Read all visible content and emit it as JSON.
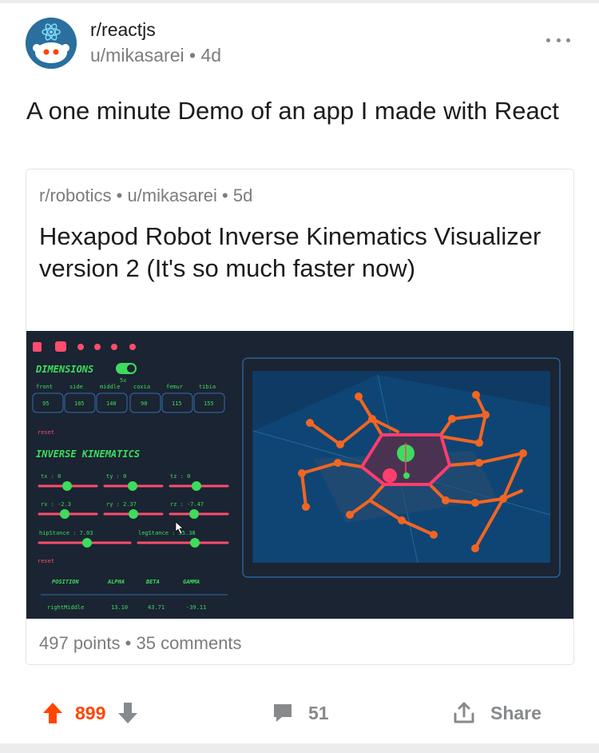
{
  "post": {
    "subreddit": "r/reactjs",
    "author": "u/mikasarei",
    "age": "4d",
    "title": "A one minute Demo of an app I made with React"
  },
  "crosspost": {
    "subreddit": "r/robotics",
    "author": "u/mikasarei",
    "age": "5d",
    "title": "Hexapod Robot Inverse Kinematics Visualizer version 2 (It's so much faster now)",
    "points": "497 points",
    "comments": "35 comments"
  },
  "media": {
    "dimensions_title": "DIMENSIONS",
    "scale": "5x",
    "dim_labels": [
      "front",
      "side",
      "middle",
      "coxia",
      "femur",
      "tibia"
    ],
    "dim_values": [
      "95",
      "105",
      "140",
      "90",
      "115",
      "155"
    ],
    "reset": "reset",
    "ik_title": "INVERSE KINEMATICS",
    "sliders": [
      "tx : 0",
      "ty : 0",
      "tz : 0",
      "rx : -2.3",
      "ry : 2.37",
      "rz : -7.47"
    ],
    "hip_stance": "hipStance : 7.03",
    "leg_stance": "legStance : 35.38",
    "table_headers": [
      "POSITION",
      "ALPHA",
      "BETA",
      "GAMMA"
    ],
    "table_row": [
      "rightMiddle",
      "13.10",
      "43.71",
      "-39.11"
    ],
    "accent": "#3ddc5c",
    "leg_color": "#f26522",
    "body_color": "#ff3d6e"
  },
  "actions": {
    "score": "899",
    "comments": "51",
    "share": "Share"
  },
  "colors": {
    "upvote": "#ff4500",
    "muted": "#878a8c"
  }
}
